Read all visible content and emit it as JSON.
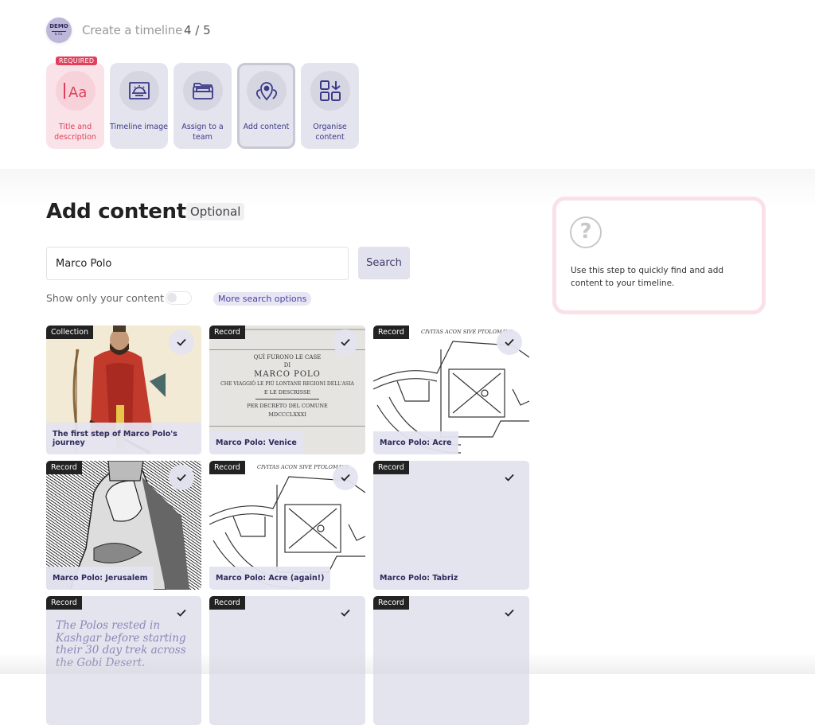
{
  "header": {
    "brand": {
      "line1": "DEMO",
      "line2": "& Co."
    },
    "wizard_title": "Create a timeline",
    "wizard_step": "4 / 5"
  },
  "steps": [
    {
      "label": "Title and description",
      "icon": "text-aa-icon",
      "badge": "REQUIRED",
      "state": "required"
    },
    {
      "label": "Timeline image",
      "icon": "sunrise-image-icon",
      "state": "default"
    },
    {
      "label": "Assign to a team",
      "icon": "folder-icon",
      "state": "default"
    },
    {
      "label": "Add content",
      "icon": "map-pins-icon",
      "state": "active"
    },
    {
      "label": "Organise content",
      "icon": "grid-download-icon",
      "state": "default"
    }
  ],
  "main": {
    "title": "Add content",
    "optional_badge": "Optional",
    "search": {
      "value": "Marco Polo",
      "button": "Search"
    },
    "filter": {
      "label": "Show only your content",
      "toggle_on": false
    },
    "more_options": "More search options"
  },
  "help": {
    "icon": "question-circle-icon",
    "text": "Use this step to quickly find and add content to your timeline."
  },
  "results": [
    {
      "type": "Collection",
      "caption": "The first step of Marco Polo's journey",
      "image": "portrait-red-robe",
      "selected": true
    },
    {
      "type": "Record",
      "caption": "Marco Polo: Venice",
      "image": "marble-plaque",
      "selected": true,
      "plaque_lines": [
        "QUÌ FURONO LE CASE",
        "DI",
        "MARCO POLO",
        "CHE VIAGGIÒ LE PIÙ LONTANE REGIONI DELL'ASIA",
        "E LE DESCRISSE",
        "PER DECRETO DEL COMUNE",
        "MDCCCLXXXI"
      ]
    },
    {
      "type": "Record",
      "caption": "Marco Polo: Acre",
      "image": "city-map",
      "selected": true,
      "map_title": "CIVITAS ACON SIVE PTOLOMAYS"
    },
    {
      "type": "Record",
      "caption": "Marco Polo: Jerusalem",
      "image": "engraving-pope",
      "selected": true
    },
    {
      "type": "Record",
      "caption": "Marco Polo: Acre (again!)",
      "image": "city-map",
      "selected": true,
      "map_title": "CIVITAS ACON SIVE PTOLOMAYS"
    },
    {
      "type": "Record",
      "caption": "Marco Polo: Tabriz",
      "image": "none",
      "selected": true
    },
    {
      "type": "Record",
      "caption": "",
      "quote": "The Polos rested in Kashgar before starting their 30 day trek across the Gobi Desert.",
      "image": "none",
      "selected": true
    },
    {
      "type": "Record",
      "caption": "",
      "image": "none",
      "selected": true
    },
    {
      "type": "Record",
      "caption": "",
      "image": "none",
      "selected": true
    }
  ]
}
